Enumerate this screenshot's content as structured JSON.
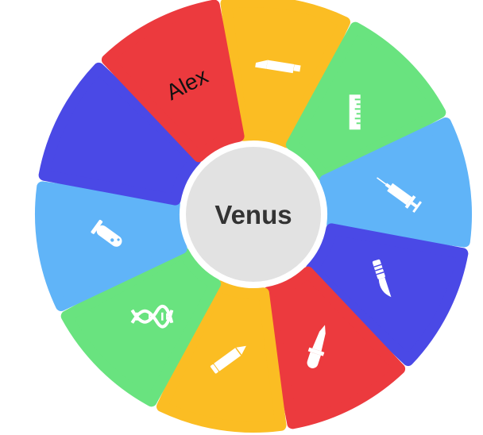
{
  "center": {
    "label": "Venus",
    "color": "#e2e2e2",
    "text_color": "#333333"
  },
  "segments": [
    {
      "id": "pen",
      "color": "#fbbd23",
      "icon": "pen-icon",
      "label": ""
    },
    {
      "id": "ruler",
      "color": "#69e37f",
      "icon": "ruler-icon",
      "label": ""
    },
    {
      "id": "syringe",
      "color": "#60b4f8",
      "icon": "syringe-icon",
      "label": ""
    },
    {
      "id": "scalpel",
      "color": "#4a49e6",
      "icon": "scalpel-icon",
      "label": ""
    },
    {
      "id": "dropper",
      "color": "#ec3a3e",
      "icon": "dropper-icon",
      "label": ""
    },
    {
      "id": "pencil",
      "color": "#fbbd23",
      "icon": "pencil-icon",
      "label": ""
    },
    {
      "id": "dna",
      "color": "#69e37f",
      "icon": "dna-icon",
      "label": ""
    },
    {
      "id": "test-tube",
      "color": "#60b4f8",
      "icon": "test-tube-icon",
      "label": ""
    },
    {
      "id": "blank",
      "color": "#4a49e6",
      "icon": "",
      "label": ""
    },
    {
      "id": "alex",
      "color": "#ec3a3e",
      "icon": "",
      "label": "Alex"
    }
  ]
}
